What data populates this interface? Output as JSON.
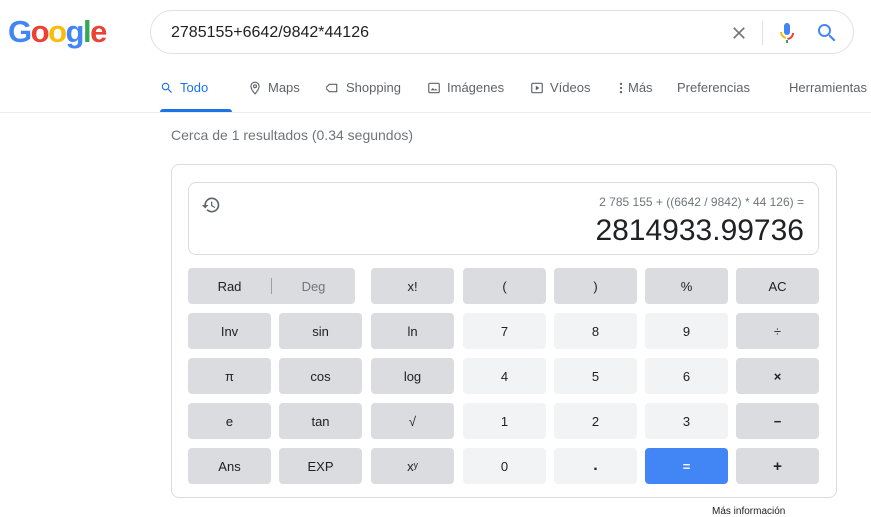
{
  "logo": {
    "text": "Google",
    "letters": [
      {
        "ch": "G",
        "color": "#4285f4"
      },
      {
        "ch": "o",
        "color": "#ea4335"
      },
      {
        "ch": "o",
        "color": "#fbbc05"
      },
      {
        "ch": "g",
        "color": "#4285f4"
      },
      {
        "ch": "l",
        "color": "#34a853"
      },
      {
        "ch": "e",
        "color": "#ea4335"
      }
    ]
  },
  "search": {
    "value": "2785155+6642/9842*44126",
    "clear_icon": "close-icon",
    "mic_icon": "mic-icon",
    "search_icon": "search-icon"
  },
  "tabs": [
    {
      "label": "Todo",
      "icon": "search-icon",
      "active": true
    },
    {
      "label": "Maps",
      "icon": "map-pin-icon"
    },
    {
      "label": "Shopping",
      "icon": "tag-icon"
    },
    {
      "label": "Imágenes",
      "icon": "image-icon"
    },
    {
      "label": "Vídeos",
      "icon": "video-icon"
    },
    {
      "label": "Más",
      "icon": "more-vert-icon"
    },
    {
      "label": "Preferencias"
    },
    {
      "label": "Herramientas"
    }
  ],
  "stats": "Cerca de 1 resultados (0.34 segundos)",
  "calculator": {
    "expression": "2 785 155 + ((6642 / 9842) * 44 126) =",
    "result": "2814933.99736",
    "history_icon": "history-icon",
    "keys": {
      "rad": "Rad",
      "deg": "Deg",
      "fact": "x!",
      "lparen": "(",
      "rparen": ")",
      "percent": "%",
      "ac": "AC",
      "inv": "Inv",
      "sin": "sin",
      "ln": "ln",
      "k7": "7",
      "k8": "8",
      "k9": "9",
      "div": "÷",
      "pi": "π",
      "cos": "cos",
      "log": "log",
      "k4": "4",
      "k5": "5",
      "k6": "6",
      "mul": "×",
      "e": "e",
      "tan": "tan",
      "sqrt": "√",
      "k1": "1",
      "k2": "2",
      "k3": "3",
      "minus": "−",
      "ans": "Ans",
      "exp": "EXP",
      "pow": "xʸ",
      "k0": "0",
      "dot": ".",
      "eq": "=",
      "plus": "+"
    }
  },
  "more_info": "Más información",
  "colors": {
    "accent": "#1a73e8",
    "equals": "#4285f4",
    "fn_key": "#dadce0",
    "num_key": "#f1f3f4"
  }
}
